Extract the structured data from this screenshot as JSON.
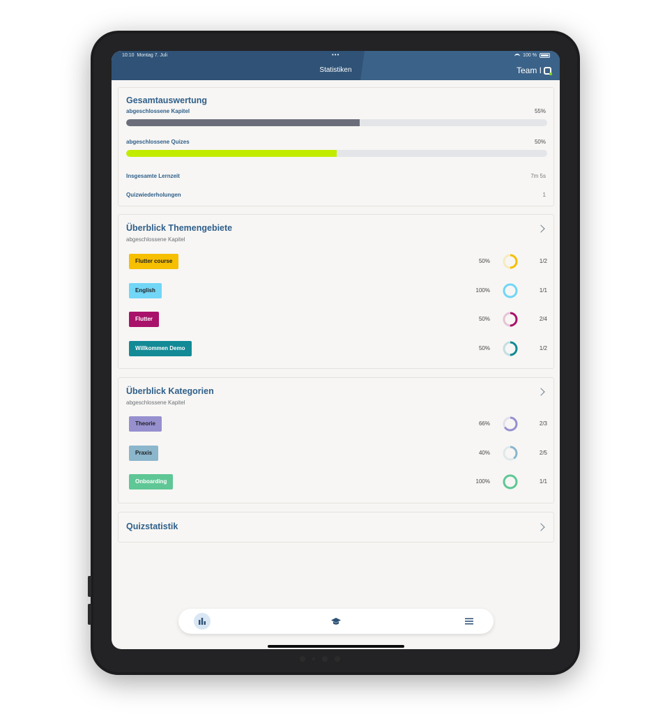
{
  "status_bar": {
    "time": "10:10",
    "date": "Montag 7. Juli",
    "dots": "•••",
    "battery": "100 %"
  },
  "header": {
    "title": "Statistiken",
    "brand": "Team I"
  },
  "overall": {
    "title": "Gesamtauswertung",
    "chapters_label": "abgeschlossene Kapitel",
    "chapters_value": "55%",
    "chapters_progress": 0.555,
    "quizzes_label": "abgeschlossene Quizes",
    "quizzes_value": "50%",
    "quizzes_progress": 0.5,
    "learn_time_label": "Insgesamte Lernzeit",
    "learn_time_value": "7m 5s",
    "repeats_label": "Quizwiederholungen",
    "repeats_value": "1",
    "colors": {
      "chapters": "#6b6e7a",
      "quizzes": "#c1ec00"
    }
  },
  "topics": {
    "title": "Überblick Themengebiete",
    "subtitle": "abgeschlossene Kapitel",
    "items": [
      {
        "label": "Flutter course",
        "pct": "50%",
        "frac": "1/2",
        "progress": 0.5,
        "color": "#f6bf00",
        "text_color": "#222222"
      },
      {
        "label": "English",
        "pct": "100%",
        "frac": "1/1",
        "progress": 1.0,
        "color": "#72d6f7",
        "text_color": "#222222"
      },
      {
        "label": "Flutter",
        "pct": "50%",
        "frac": "2/4",
        "progress": 0.5,
        "color": "#a8126a",
        "text_color": "#ffffff"
      },
      {
        "label": "Willkommen Demo",
        "pct": "50%",
        "frac": "1/2",
        "progress": 0.5,
        "color": "#138a96",
        "text_color": "#ffffff"
      }
    ]
  },
  "categories": {
    "title": "Überblick Kategorien",
    "subtitle": "abgeschlossene Kapitel",
    "items": [
      {
        "label": "Theorie",
        "pct": "66%",
        "frac": "2/3",
        "progress": 0.66,
        "color": "#9690cf",
        "text_color": "#222222"
      },
      {
        "label": "Praxis",
        "pct": "40%",
        "frac": "2/5",
        "progress": 0.4,
        "color": "#8bb6cc",
        "text_color": "#222222"
      },
      {
        "label": "Onboarding",
        "pct": "100%",
        "frac": "1/1",
        "progress": 1.0,
        "color": "#5fc795",
        "text_color": "#ffffff"
      }
    ]
  },
  "quiz": {
    "title": "Quizstatistik"
  },
  "nav": {
    "items": [
      "statistics-icon",
      "graduation-cap-icon",
      "menu-icon"
    ],
    "active": "statistics-icon"
  }
}
